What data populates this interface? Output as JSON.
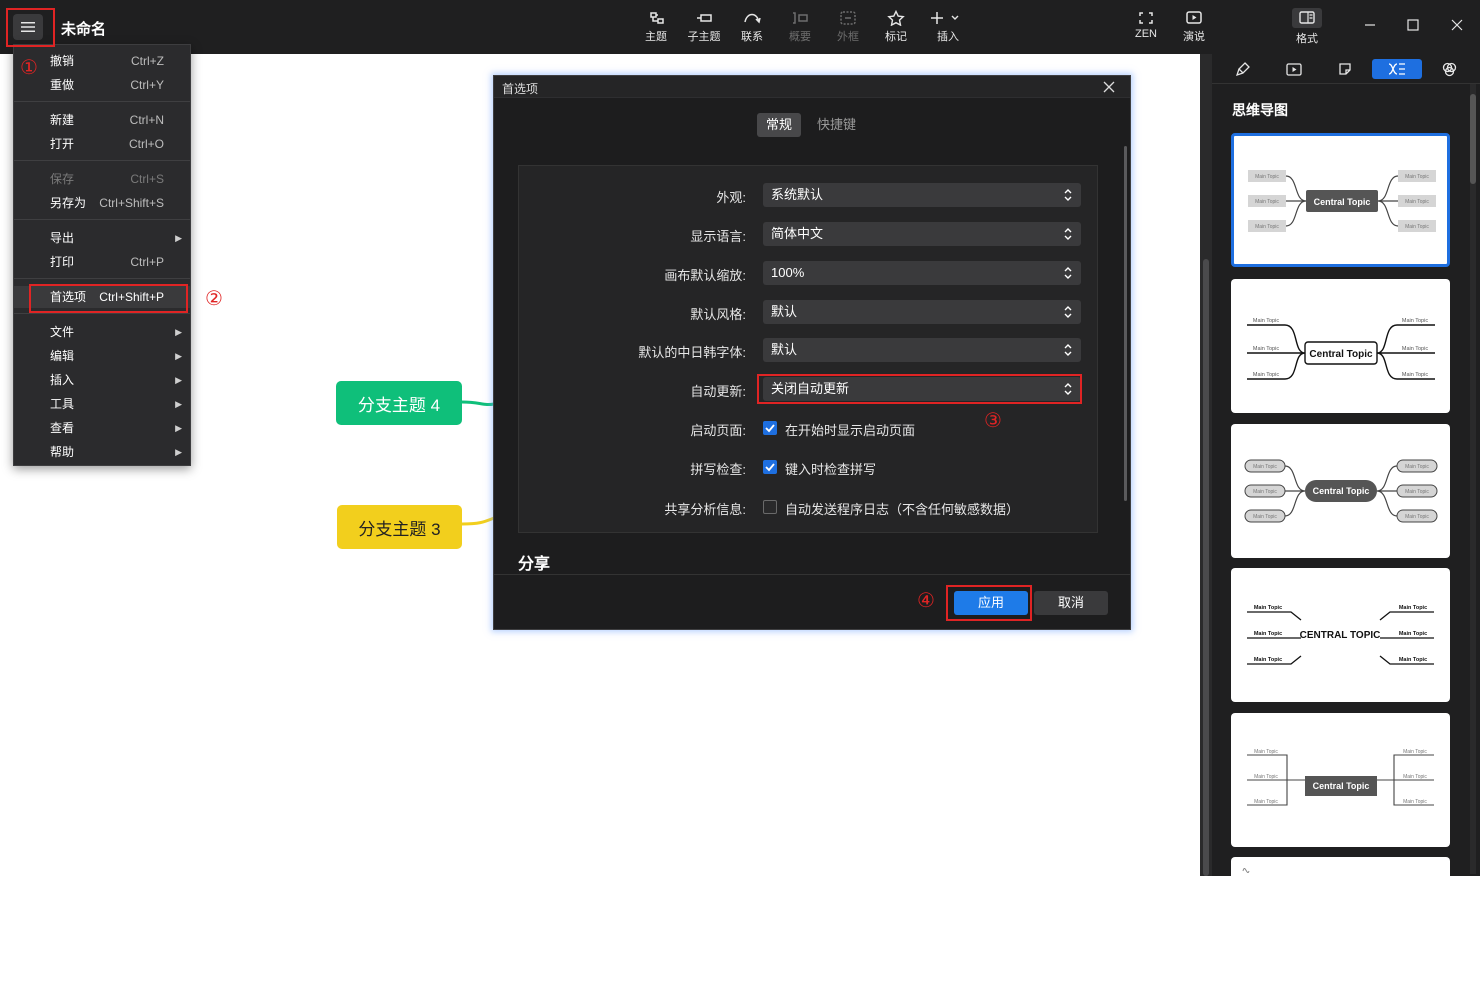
{
  "app": {
    "doc_title": "未命名"
  },
  "toolbar": {
    "items": [
      {
        "label": "主题",
        "icon": "topic-icon",
        "enabled": true
      },
      {
        "label": "子主题",
        "icon": "subtopic-icon",
        "enabled": true
      },
      {
        "label": "联系",
        "icon": "relationship-icon",
        "enabled": true
      },
      {
        "label": "概要",
        "icon": "summary-icon",
        "enabled": false
      },
      {
        "label": "外框",
        "icon": "boundary-icon",
        "enabled": false
      },
      {
        "label": "标记",
        "icon": "star-icon",
        "enabled": true
      },
      {
        "label": "插入",
        "icon": "plus-icon",
        "enabled": true
      }
    ],
    "zen_label": "ZEN",
    "present_label": "演说",
    "format_label": "格式"
  },
  "menu": {
    "undo": {
      "label": "撤销",
      "shortcut": "Ctrl+Z"
    },
    "redo": {
      "label": "重做",
      "shortcut": "Ctrl+Y"
    },
    "new": {
      "label": "新建",
      "shortcut": "Ctrl+N"
    },
    "open": {
      "label": "打开",
      "shortcut": "Ctrl+O"
    },
    "save": {
      "label": "保存",
      "shortcut": "Ctrl+S"
    },
    "save_as": {
      "label": "另存为",
      "shortcut": "Ctrl+Shift+S"
    },
    "export": {
      "label": "导出"
    },
    "print": {
      "label": "打印",
      "shortcut": "Ctrl+P"
    },
    "preferences": {
      "label": "首选项",
      "shortcut": "Ctrl+Shift+P"
    },
    "file": {
      "label": "文件"
    },
    "edit": {
      "label": "编辑"
    },
    "insert": {
      "label": "插入"
    },
    "tools": {
      "label": "工具"
    },
    "view": {
      "label": "查看"
    },
    "help": {
      "label": "帮助"
    }
  },
  "annotations": {
    "n1": "①",
    "n2": "②",
    "n3": "③",
    "n4": "④"
  },
  "canvas": {
    "nodes": [
      {
        "label": "分支主题 4",
        "color": "#0fbf7a"
      },
      {
        "label": "分支主题 3",
        "color": "#f2cf1d"
      }
    ]
  },
  "dialog": {
    "title": "首选项",
    "tabs": {
      "general": "常规",
      "shortcuts": "快捷键"
    },
    "fields": {
      "appearance": {
        "label": "外观:",
        "value": "系统默认"
      },
      "language": {
        "label": "显示语言:",
        "value": "简体中文"
      },
      "zoom": {
        "label": "画布默认缩放:",
        "value": "100%"
      },
      "style": {
        "label": "默认风格:",
        "value": "默认"
      },
      "cjk_font": {
        "label": "默认的中日韩字体:",
        "value": "默认"
      },
      "auto_update": {
        "label": "自动更新:",
        "value": "关闭自动更新"
      },
      "startup": {
        "label": "启动页面:",
        "option": "在开始时显示启动页面",
        "checked": true
      },
      "spell": {
        "label": "拼写检查:",
        "option": "键入时检查拼写",
        "checked": true
      },
      "analytics": {
        "label": "共享分析信息:",
        "option": "自动发送程序日志（不含任何敏感数据）",
        "checked": false
      }
    },
    "section_share": "分享",
    "apply_label": "应用",
    "cancel_label": "取消"
  },
  "sidepanel": {
    "title": "思维导图",
    "template_central": "Central Topic",
    "template_central_caps": "CENTRAL TOPIC",
    "template_main": "Main Topic"
  },
  "colors": {
    "accent": "#1e6fe0",
    "highlight": "#e02424",
    "dark_bg": "#1f1f20"
  }
}
